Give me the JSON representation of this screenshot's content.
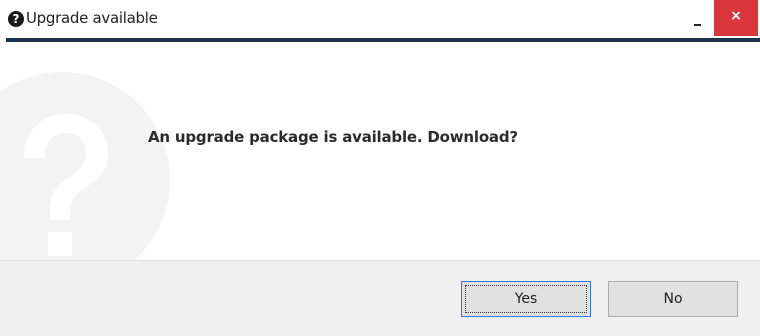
{
  "window": {
    "title": "Upgrade available",
    "title_icon": "question-circle-icon",
    "controls": {
      "minimize_icon": "minimize-icon",
      "close_icon": "close-icon",
      "close_glyph": "×",
      "close_color": "#d9373b"
    }
  },
  "dialog": {
    "background_icon": "question-mark-icon",
    "message": "An upgrade package is available. Download?"
  },
  "buttons": {
    "yes_label": "Yes",
    "no_label": "No",
    "focused": "Yes"
  },
  "colors": {
    "title_rule": "#1d3050",
    "footer_bg": "#f0f0f0",
    "focus_border": "#2d7ad6"
  }
}
